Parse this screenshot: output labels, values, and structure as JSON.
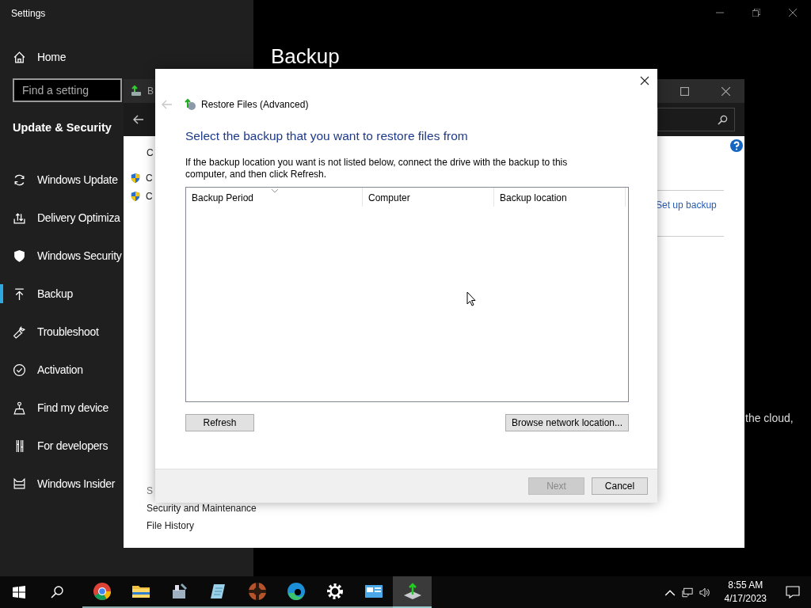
{
  "settings_window": {
    "title": "Settings",
    "home": "Home",
    "search": {
      "placeholder": "Find a setting"
    },
    "section": "Update & Security",
    "page_title": "Backup",
    "partial_text": "the cloud,",
    "nav": [
      {
        "label": "Windows Update",
        "selected": false
      },
      {
        "label": "Delivery Optimiza",
        "selected": false
      },
      {
        "label": "Windows Security",
        "selected": false
      },
      {
        "label": "Backup",
        "selected": true
      },
      {
        "label": "Troubleshoot",
        "selected": false
      },
      {
        "label": "Activation",
        "selected": false
      },
      {
        "label": "Find my device",
        "selected": false
      },
      {
        "label": "For developers",
        "selected": false
      },
      {
        "label": "Windows Insider",
        "selected": false
      }
    ]
  },
  "control_panel_window": {
    "title": "B",
    "heading": "C",
    "tasks": [
      "C",
      "C"
    ],
    "link": "Set up backup",
    "see_also_heading": "S",
    "see_also": [
      "Security and Maintenance",
      "File History"
    ]
  },
  "dialog": {
    "title": "Restore Files (Advanced)",
    "heading": "Select the backup that you want to restore files from",
    "instructions": "If the backup location you want is not listed below, connect the drive with the backup to this computer, and then click Refresh.",
    "columns": [
      "Backup Period",
      "Computer",
      "Backup location"
    ],
    "buttons": [
      {
        "label": "Refresh"
      },
      {
        "label": "Browse network location..."
      }
    ],
    "footer_buttons": [
      {
        "label": "Next",
        "disabled": true
      },
      {
        "label": "Cancel",
        "disabled": false
      }
    ]
  },
  "taskbar": {
    "apps": [
      {
        "selected": false
      },
      {
        "selected": false
      },
      {
        "selected": false
      },
      {
        "selected": false
      },
      {
        "selected": false
      },
      {
        "selected": false
      },
      {
        "selected": false
      },
      {
        "selected": false
      },
      {
        "selected": true
      }
    ],
    "time": "8:55 AM",
    "date": "4/17/2023"
  }
}
